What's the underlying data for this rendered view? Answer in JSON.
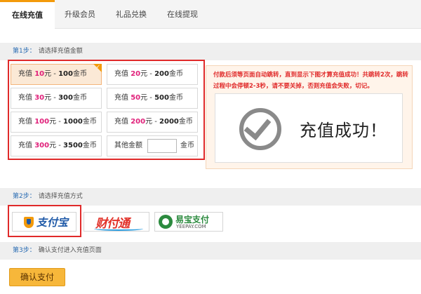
{
  "tabs": [
    "在线充值",
    "升级会员",
    "礼品兑换",
    "在线提现"
  ],
  "steps": [
    {
      "num": "第1步：",
      "text": "请选择充值金额"
    },
    {
      "num": "第2步：",
      "text": "请选择充值方式"
    },
    {
      "num": "第3步：",
      "text": "确认支付进入充值页面"
    }
  ],
  "amounts": [
    {
      "prefix": "充值",
      "yuan": "10",
      "mid": "元 - ",
      "coins": "100",
      "suffix": "金币"
    },
    {
      "prefix": "充值",
      "yuan": "20",
      "mid": "元 - ",
      "coins": "200",
      "suffix": "金币"
    },
    {
      "prefix": "充值",
      "yuan": "30",
      "mid": "元 - ",
      "coins": "300",
      "suffix": "金币"
    },
    {
      "prefix": "充值",
      "yuan": "50",
      "mid": "元 - ",
      "coins": "500",
      "suffix": "金币"
    },
    {
      "prefix": "充值",
      "yuan": "100",
      "mid": "元 - ",
      "coins": "1000",
      "suffix": "金币"
    },
    {
      "prefix": "充值",
      "yuan": "200",
      "mid": "元 - ",
      "coins": "2000",
      "suffix": "金币"
    },
    {
      "prefix": "充值",
      "yuan": "300",
      "mid": "元 - ",
      "coins": "3500",
      "suffix": "金币"
    }
  ],
  "other": {
    "label": "其他金额",
    "value": "",
    "unit": "金币"
  },
  "notice": "付款后须等页面自动跳转，直到显示下图才算充值成功！共跳转2次，跳转过程中会停顿2-3秒，请不要关掉，否则充值会失败，切记。",
  "success": "充值成功！",
  "payments": {
    "alipay": "支付宝",
    "tenpay": "财付通",
    "yeepay_cn": "易宝支付",
    "yeepay_en": "YEEPAY.COM"
  },
  "confirm_label": "确认支付",
  "colors": {
    "accent": "#f39a0b",
    "highlight": "#e02a2a",
    "step": "#2a6cb3"
  }
}
